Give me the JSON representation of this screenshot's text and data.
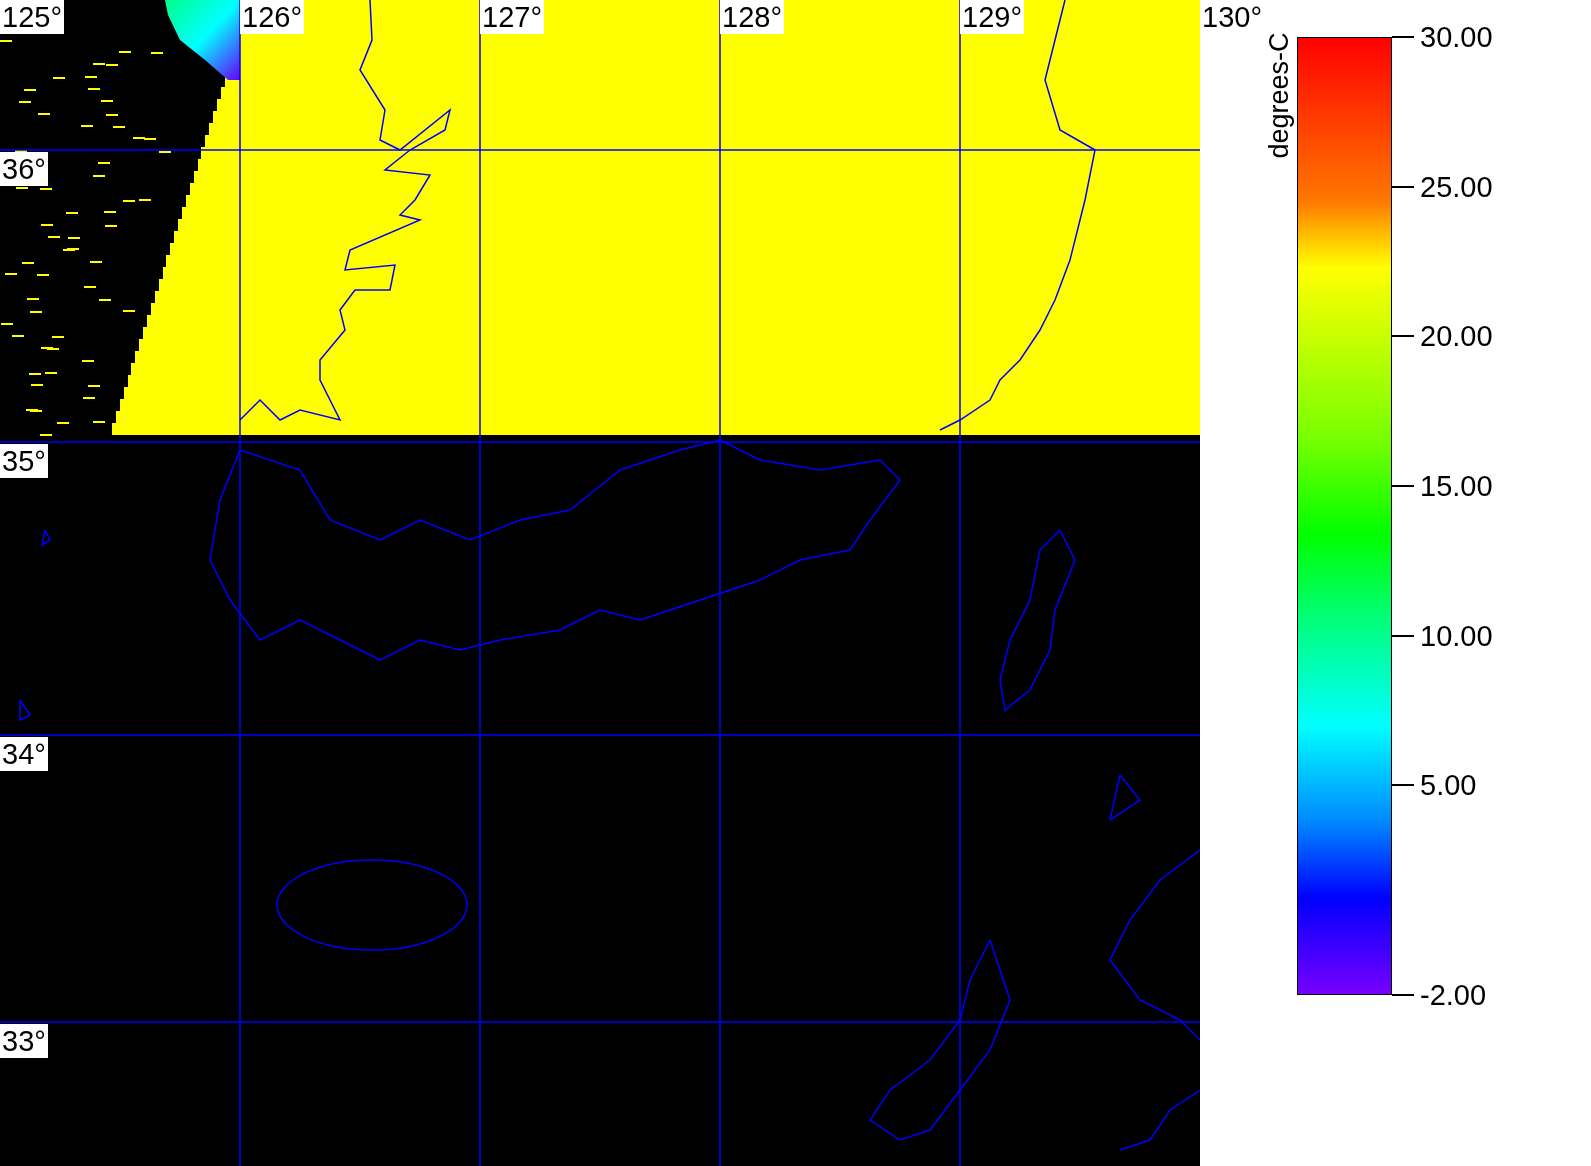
{
  "map": {
    "longitude_labels": [
      "125°",
      "126°",
      "127°",
      "128°",
      "129°",
      "130°"
    ],
    "latitude_labels": [
      "36°",
      "35°",
      "34°",
      "33°"
    ]
  },
  "legend": {
    "unit": "degrees-C",
    "ticks": [
      "30.00",
      "25.00",
      "20.00",
      "15.00",
      "10.00",
      "5.00",
      "-2.00"
    ]
  }
}
